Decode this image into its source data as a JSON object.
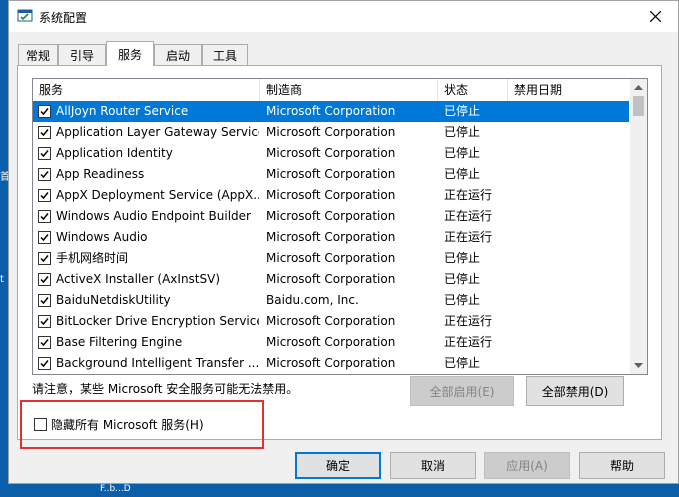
{
  "window": {
    "title": "系统配置"
  },
  "tabs": [
    "常规",
    "引导",
    "服务",
    "启动",
    "工具"
  ],
  "active_tab": 2,
  "table": {
    "headers": [
      "服务",
      "制造商",
      "状态",
      "禁用日期"
    ],
    "rows": [
      {
        "name": "AllJoyn Router Service",
        "maker": "Microsoft Corporation",
        "status": "已停止",
        "date": "",
        "checked": true,
        "selected": true
      },
      {
        "name": "Application Layer Gateway Service",
        "maker": "Microsoft Corporation",
        "status": "已停止",
        "date": "",
        "checked": true
      },
      {
        "name": "Application Identity",
        "maker": "Microsoft Corporation",
        "status": "已停止",
        "date": "",
        "checked": true
      },
      {
        "name": "App Readiness",
        "maker": "Microsoft Corporation",
        "status": "已停止",
        "date": "",
        "checked": true
      },
      {
        "name": "AppX Deployment Service (AppX...",
        "maker": "Microsoft Corporation",
        "status": "正在运行",
        "date": "",
        "checked": true
      },
      {
        "name": "Windows Audio Endpoint Builder",
        "maker": "Microsoft Corporation",
        "status": "正在运行",
        "date": "",
        "checked": true
      },
      {
        "name": "Windows Audio",
        "maker": "Microsoft Corporation",
        "status": "正在运行",
        "date": "",
        "checked": true
      },
      {
        "name": "手机网络时间",
        "maker": "Microsoft Corporation",
        "status": "已停止",
        "date": "",
        "checked": true
      },
      {
        "name": "ActiveX Installer (AxInstSV)",
        "maker": "Microsoft Corporation",
        "status": "已停止",
        "date": "",
        "checked": true
      },
      {
        "name": "BaiduNetdiskUtility",
        "maker": "Baidu.com, Inc.",
        "status": "已停止",
        "date": "",
        "checked": true
      },
      {
        "name": "BitLocker Drive Encryption Service",
        "maker": "Microsoft Corporation",
        "status": "正在运行",
        "date": "",
        "checked": true
      },
      {
        "name": "Base Filtering Engine",
        "maker": "Microsoft Corporation",
        "status": "正在运行",
        "date": "",
        "checked": true
      },
      {
        "name": "Background Intelligent Transfer ...",
        "maker": "Microsoft Corporation",
        "status": "已停止",
        "date": "",
        "checked": true
      }
    ]
  },
  "note": "请注意，某些 Microsoft 安全服务可能无法禁用。",
  "buttons": {
    "enable_all": "全部启用(E)",
    "disable_all": "全部禁用(D)",
    "ok": "确定",
    "cancel": "取消",
    "apply": "应用(A)",
    "help": "帮助"
  },
  "hide_ms": {
    "label": "隐藏所有 Microsoft 服务(H)",
    "checked": false
  },
  "desktop": {
    "left_glyphs": [
      "首",
      "t"
    ],
    "bottom_text": "F..b...D"
  },
  "colors": {
    "selected": "#0078d7",
    "highlight_box": "#e0312f"
  }
}
